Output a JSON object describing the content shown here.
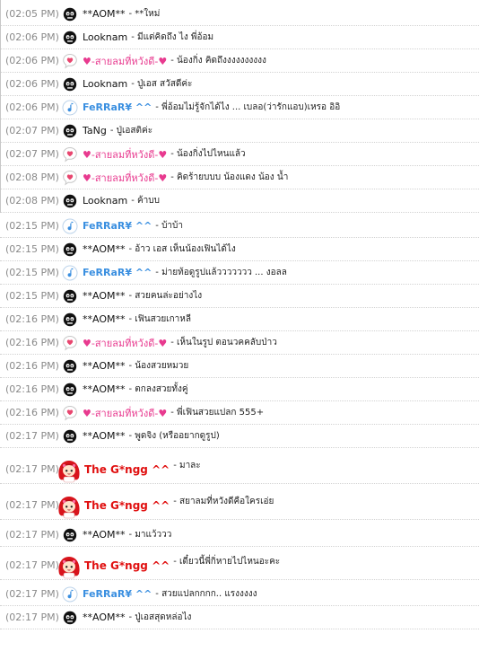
{
  "messages": [
    {
      "time": "(02:05 PM)",
      "user": "**AOM**",
      "icon": "skull-icon",
      "style": "black",
      "text": "- **ใหม่"
    },
    {
      "time": "(02:06 PM)",
      "user": "Looknam",
      "icon": "skull-icon",
      "style": "black",
      "text": "- มีแต่คิดถึง ไง พี่อ้อม"
    },
    {
      "time": "(02:06 PM)",
      "user": "♥-สายลมที่หวังดี-♥",
      "icon": "heart-bubble-icon",
      "style": "pink",
      "text": "- น้องกิ่ง คิดถึงงงงงงงงงง"
    },
    {
      "time": "(02:06 PM)",
      "user": "Looknam",
      "icon": "skull-icon",
      "style": "black",
      "text": "- ปู่เอส สวัสดีค่ะ"
    },
    {
      "time": "(02:06 PM)",
      "user": "FeRRaR¥ ^^",
      "icon": "music-note-icon",
      "style": "blue",
      "text": "- พี่อ้อมไม่รู้จักได้ไง ... เบลอ(ว่ารักแอบ)เหรอ อิอิ"
    },
    {
      "time": "(02:07 PM)",
      "user": "TaNg",
      "icon": "skull-icon",
      "style": "black",
      "text": "- ปู่เอสติค่ะ"
    },
    {
      "time": "(02:07 PM)",
      "user": "♥-สายลมที่หวังดี-♥",
      "icon": "heart-bubble-icon",
      "style": "pink",
      "text": "- น้องกิ่งไปไหนแล้ว"
    },
    {
      "time": "(02:08 PM)",
      "user": "♥-สายลมที่หวังดี-♥",
      "icon": "heart-bubble-icon",
      "style": "pink",
      "text": "- คิดร้ายบบบ น้องแดง น้อง น้ำ"
    },
    {
      "time": "(02:08 PM)",
      "user": "Looknam",
      "icon": "skull-icon",
      "style": "black",
      "text": "- ค้าบบ"
    },
    {
      "time": "(02:15 PM)",
      "user": "FeRRaR¥ ^^",
      "icon": "music-note-icon",
      "style": "blue",
      "text": "- บ้าบ้า"
    },
    {
      "time": "(02:15 PM)",
      "user": "**AOM**",
      "icon": "skull-icon",
      "style": "black",
      "text": "- อ้าว เอส เห็นน้องเฟินได้ไง"
    },
    {
      "time": "(02:15 PM)",
      "user": "FeRRaR¥ ^^",
      "icon": "music-note-icon",
      "style": "blue",
      "text": "- ม่ายท้อดูรูปแล้ววววววว ... งอลล"
    },
    {
      "time": "(02:15 PM)",
      "user": "**AOM**",
      "icon": "skull-icon",
      "style": "black",
      "text": "- สวยคนล่ะอย่างไง"
    },
    {
      "time": "(02:16 PM)",
      "user": "**AOM**",
      "icon": "skull-icon",
      "style": "black",
      "text": "- เฟินสวยเกาหลี"
    },
    {
      "time": "(02:16 PM)",
      "user": "♥-สายลมที่หวังดี-♥",
      "icon": "heart-bubble-icon",
      "style": "pink",
      "text": "- เห็นในรูป ตอนวคคลับป่าว"
    },
    {
      "time": "(02:16 PM)",
      "user": "**AOM**",
      "icon": "skull-icon",
      "style": "black",
      "text": "- น้องสวยหมวย"
    },
    {
      "time": "(02:16 PM)",
      "user": "**AOM**",
      "icon": "skull-icon",
      "style": "black",
      "text": "- ตกลงสวยทั้งคู่"
    },
    {
      "time": "(02:16 PM)",
      "user": "♥-สายลมที่หวังดี-♥",
      "icon": "heart-bubble-icon",
      "style": "pink",
      "text": "- พี่เฟินสวยแปลก 555+"
    },
    {
      "time": "(02:17 PM)",
      "user": "**AOM**",
      "icon": "skull-icon",
      "style": "black",
      "text": "- พูดจิง (หรืออยากดูรูป)"
    },
    {
      "time": "(02:17 PM)",
      "user": "The G*ngg ^^",
      "icon": "red-hair-girl-avatar",
      "style": "red",
      "text": "- มาละ"
    },
    {
      "time": "(02:17 PM)",
      "user": "The G*ngg ^^",
      "icon": "red-hair-girl-avatar",
      "style": "red",
      "text": "- สยาลมที่หวังดีคือใครเอ่ย"
    },
    {
      "time": "(02:17 PM)",
      "user": "**AOM**",
      "icon": "skull-icon",
      "style": "black",
      "text": "- มาแว้ววว"
    },
    {
      "time": "(02:17 PM)",
      "user": "The G*ngg ^^",
      "icon": "red-hair-girl-avatar",
      "style": "red",
      "text": "- เดี๋ยวนี้พี่กิ่หายไปไหนอะคะ"
    },
    {
      "time": "(02:17 PM)",
      "user": "FeRRaR¥ ^^",
      "icon": "music-note-icon",
      "style": "blue",
      "text": "- สวยแปลกกกก.. แรงงงงง"
    },
    {
      "time": "(02:17 PM)",
      "user": "**AOM**",
      "icon": "skull-icon",
      "style": "black",
      "text": "- ปู่เอสสุดหล่อไง"
    }
  ],
  "colors": {
    "timestamp": "#8a8a8a",
    "pink_user": "#e83a8f",
    "blue_user": "#3a8fe0",
    "red_user": "#e01010",
    "divider": "#d2d2d2"
  }
}
